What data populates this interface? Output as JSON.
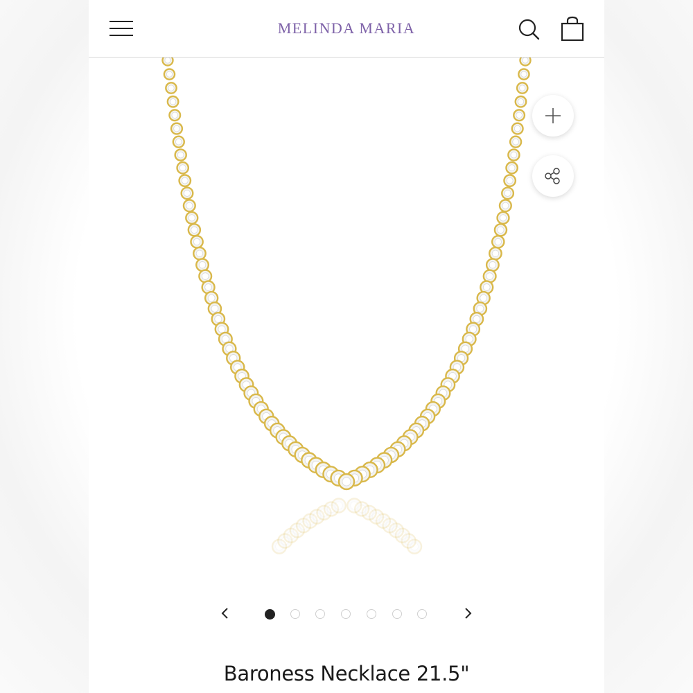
{
  "header": {
    "brand": "MELINDA MARIA",
    "menu_icon": "hamburger-menu-icon",
    "search_icon": "search-icon",
    "bag_icon": "shopping-bag-icon",
    "brand_color": "#7e62a8"
  },
  "gallery": {
    "zoom_icon": "plus-icon",
    "share_icon": "share-icon",
    "prev_icon": "chevron-left-icon",
    "next_icon": "chevron-right-icon",
    "dot_count": 7,
    "active_dot": 0,
    "metal_color": "#d9b84a"
  },
  "product": {
    "title": "Baroness Necklace 21.5\""
  }
}
